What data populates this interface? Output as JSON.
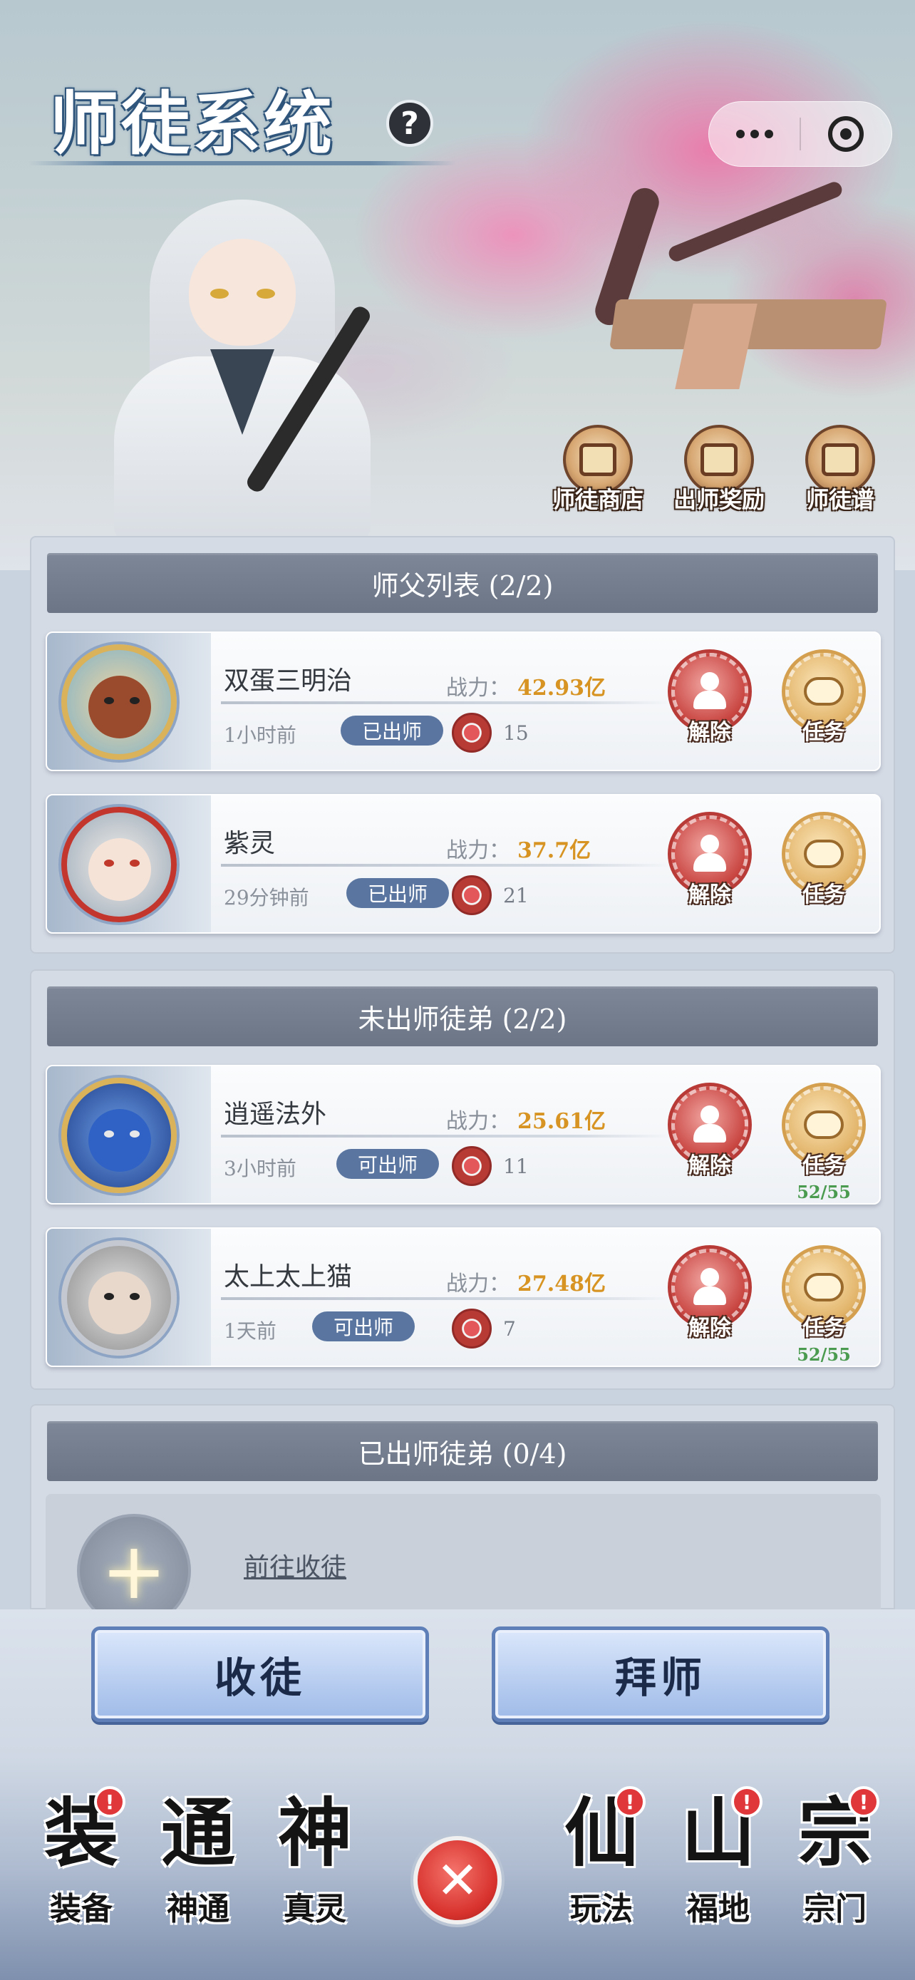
{
  "header": {
    "title": "师徒系统",
    "help_icon": "?"
  },
  "shortcuts": [
    {
      "label": "师徒商店",
      "icon": "shop-icon"
    },
    {
      "label": "出师奖励",
      "icon": "gift-icon"
    },
    {
      "label": "师徒谱",
      "icon": "book-icon"
    }
  ],
  "masters": {
    "header": "师父列表 (2/2)",
    "rows": [
      {
        "name": "双蛋三明治",
        "power_label": "战力：",
        "power": "42.93亿",
        "time": "1小时前",
        "status": "已出师",
        "intimacy": "15",
        "remove": "解除",
        "task": "任务",
        "progress": ""
      },
      {
        "name": "紫灵",
        "power_label": "战力：",
        "power": "37.7亿",
        "time": "29分钟前",
        "status": "已出师",
        "intimacy": "21",
        "remove": "解除",
        "task": "任务",
        "progress": ""
      }
    ]
  },
  "apprentices": {
    "header": "未出师徒弟 (2/2)",
    "rows": [
      {
        "name": "逍遥法外",
        "power_label": "战力：",
        "power": "25.61亿",
        "time": "3小时前",
        "status": "可出师",
        "intimacy": "11",
        "remove": "解除",
        "task": "任务",
        "progress": "52/55"
      },
      {
        "name": "太上太上猫",
        "power_label": "战力：",
        "power": "27.48亿",
        "time": "1天前",
        "status": "可出师",
        "intimacy": "7",
        "remove": "解除",
        "task": "任务",
        "progress": "52/55"
      }
    ]
  },
  "graduated": {
    "header": "已出师徒弟 (0/4)",
    "recruit_link": "前往收徒",
    "plus": "+"
  },
  "actions": {
    "recruit": "收徒",
    "apprentice": "拜师"
  },
  "nav": {
    "items": [
      {
        "label": "装备",
        "glyph": "装",
        "badge": "!"
      },
      {
        "label": "神通",
        "glyph": "通",
        "badge": ""
      },
      {
        "label": "真灵",
        "glyph": "神",
        "badge": ""
      },
      {
        "label": "玩法",
        "glyph": "仙",
        "badge": "!"
      },
      {
        "label": "福地",
        "glyph": "山",
        "badge": "!"
      },
      {
        "label": "宗门",
        "glyph": "宗",
        "badge": "!"
      }
    ],
    "close": "✕"
  },
  "colors": {
    "power": "#d79422",
    "badge": "#5a76a0",
    "header_bar": "#6b7585",
    "notify": "#e0373a"
  }
}
